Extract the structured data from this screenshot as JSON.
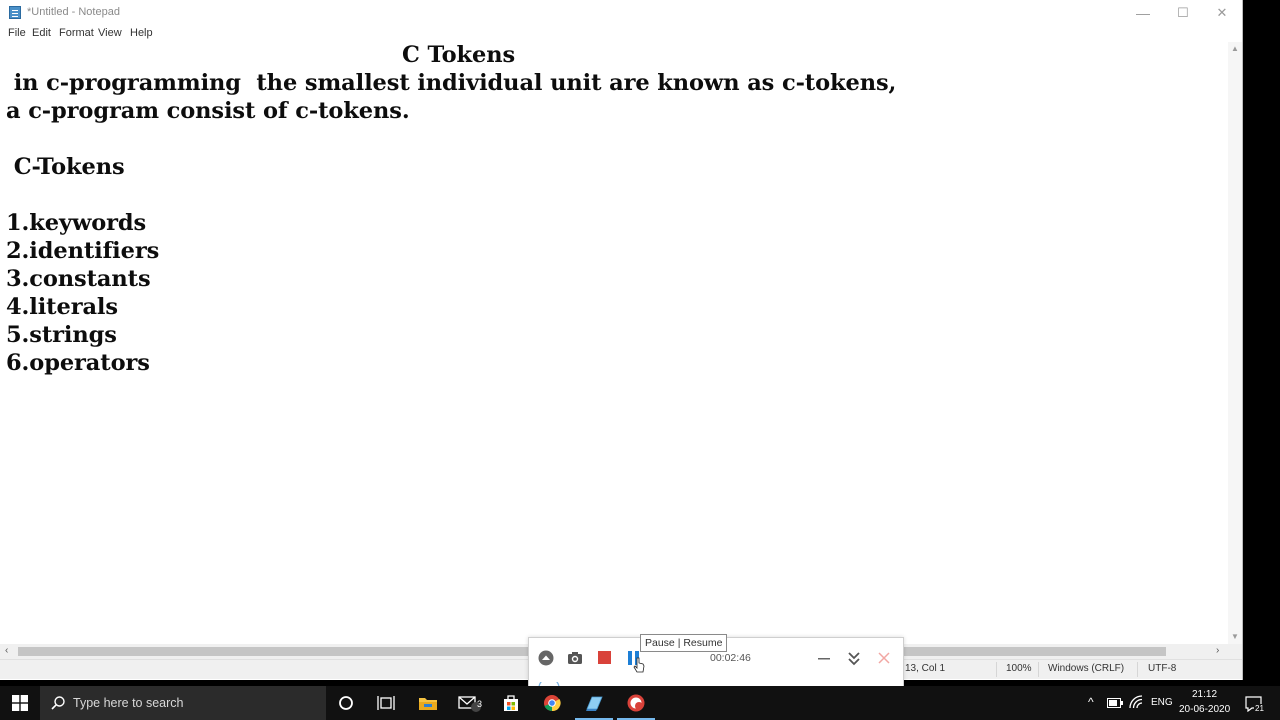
{
  "window": {
    "title": "*Untitled - Notepad",
    "controls": {
      "minimize": "—",
      "maximize": "☐",
      "close": "✕"
    }
  },
  "menu": {
    "items": [
      "File",
      "Edit",
      "Format",
      "View",
      "Help"
    ]
  },
  "document": {
    "lines": [
      "C Tokens",
      " in c-programming  the smallest individual unit are known as c-tokens,",
      "a c-program consist of c-tokens.",
      " C-Tokens",
      "1.keywords",
      "2.identifiers",
      "3.constants",
      "4.literals",
      "5.strings",
      "6.operators"
    ]
  },
  "status": {
    "position": "13, Col 1",
    "zoom": "100%",
    "line_ending": "Windows (CRLF)",
    "encoding": "UTF-8"
  },
  "recorder": {
    "timer": "00:02:46",
    "tooltip": "Pause | Resume"
  },
  "taskbar": {
    "search_placeholder": "Type here to search",
    "mail_badge": "3",
    "language": "ENG",
    "time": "21:12",
    "date": "20-06-2020",
    "notification_count": "21"
  },
  "colors": {
    "stop_red": "#d9423a",
    "pause_blue": "#1d7fd6",
    "taskbar": "#111111",
    "active_underline": "#76b9ed"
  }
}
